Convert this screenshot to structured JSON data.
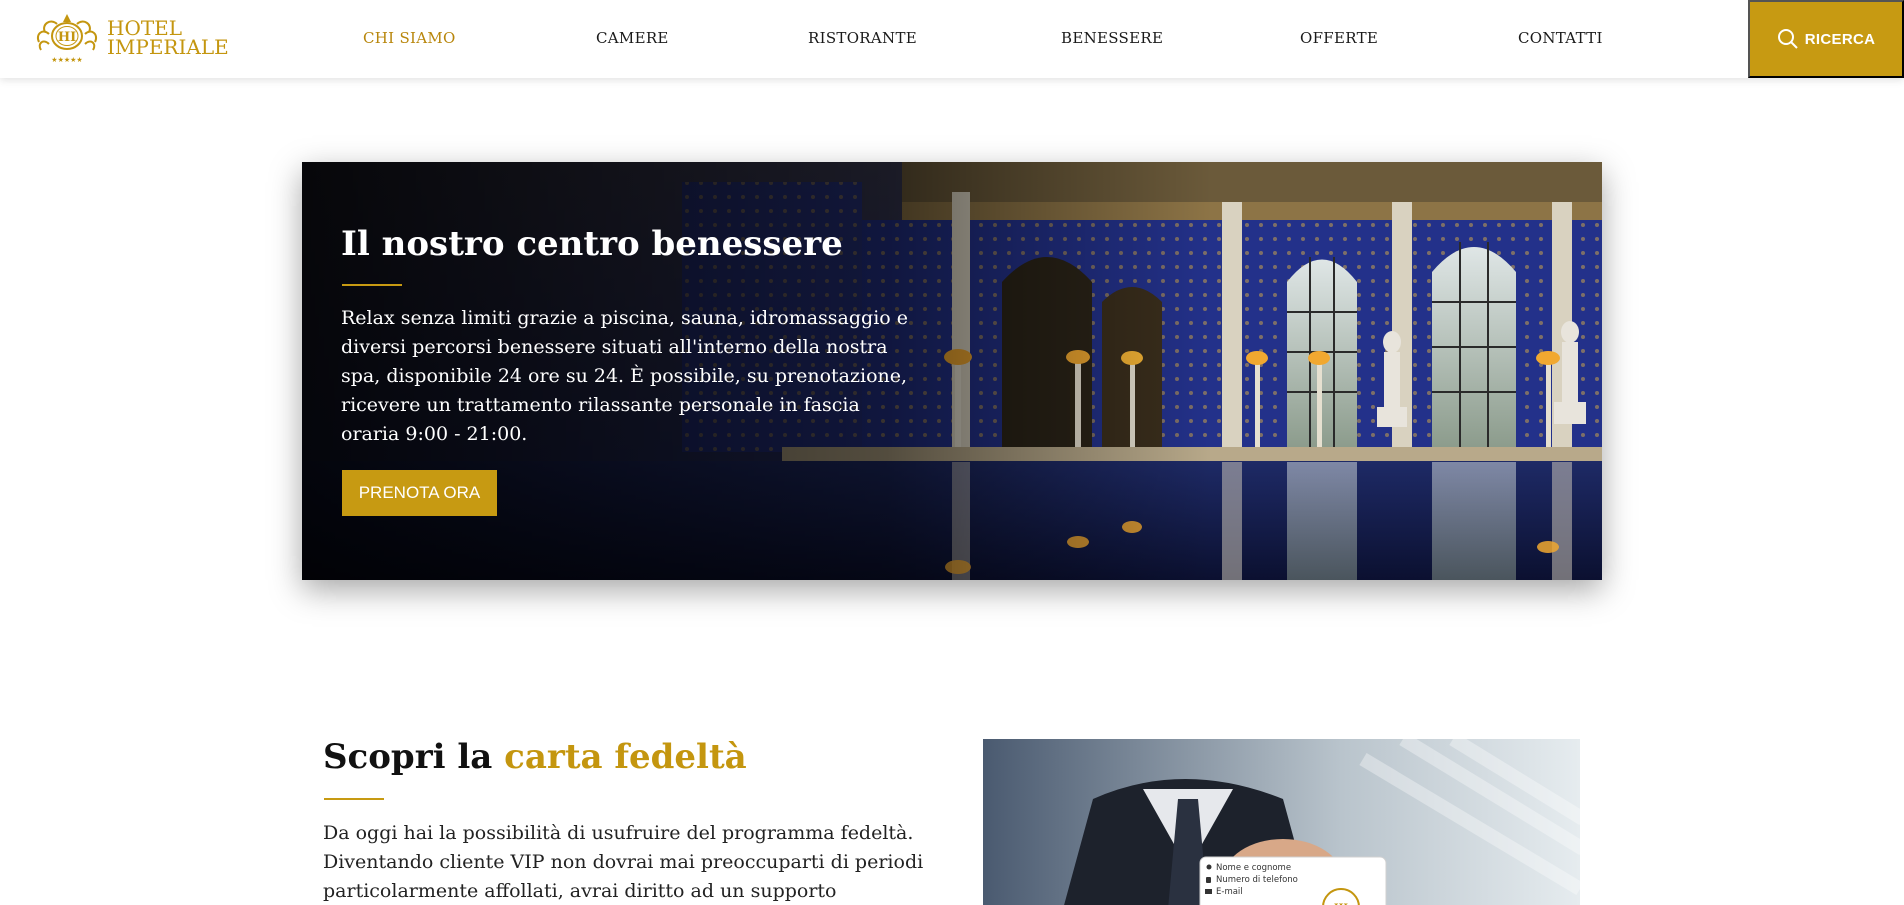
{
  "brand": {
    "line1": "HOTEL",
    "line2": "IMPERIALE",
    "monogram": "HI",
    "stars": "★★★★★",
    "color": "#c4960f"
  },
  "nav": {
    "items": [
      {
        "label": "CHI SIAMO",
        "active": true
      },
      {
        "label": "CAMERE"
      },
      {
        "label": "RISTORANTE"
      },
      {
        "label": "BENESSERE"
      },
      {
        "label": "OFFERTE"
      },
      {
        "label": "CONTATTI"
      }
    ],
    "search_label": "RICERCA",
    "search_icon": "search-icon"
  },
  "hero": {
    "title": "Il nostro centro benessere",
    "text": "Relax senza limiti grazie a piscina, sauna, idromassaggio e diversi percorsi benessere situati all'interno della nostra spa, disponibile 24 ore su 24. È possibile, su prenotazione, ricevere un trattamento rilassante personale in fascia oraria 9:00 - 21:00.",
    "button": "PRENOTA ORA"
  },
  "loyalty": {
    "title_plain": "Scopri la",
    "title_accent": "carta fedeltà",
    "text": "Da oggi hai la possibilità di usufruire del programma fedeltà. Diventando cliente VIP non dovrai mai preoccuparti di periodi particolarmente affollati, avrai diritto ad un supporto",
    "card_fields": [
      "Nome e cognome",
      "Numero di telefono",
      "E-mail"
    ],
    "card_monogram": "HI"
  },
  "colors": {
    "accent": "#c79a12",
    "text": "#1a1a1a"
  }
}
